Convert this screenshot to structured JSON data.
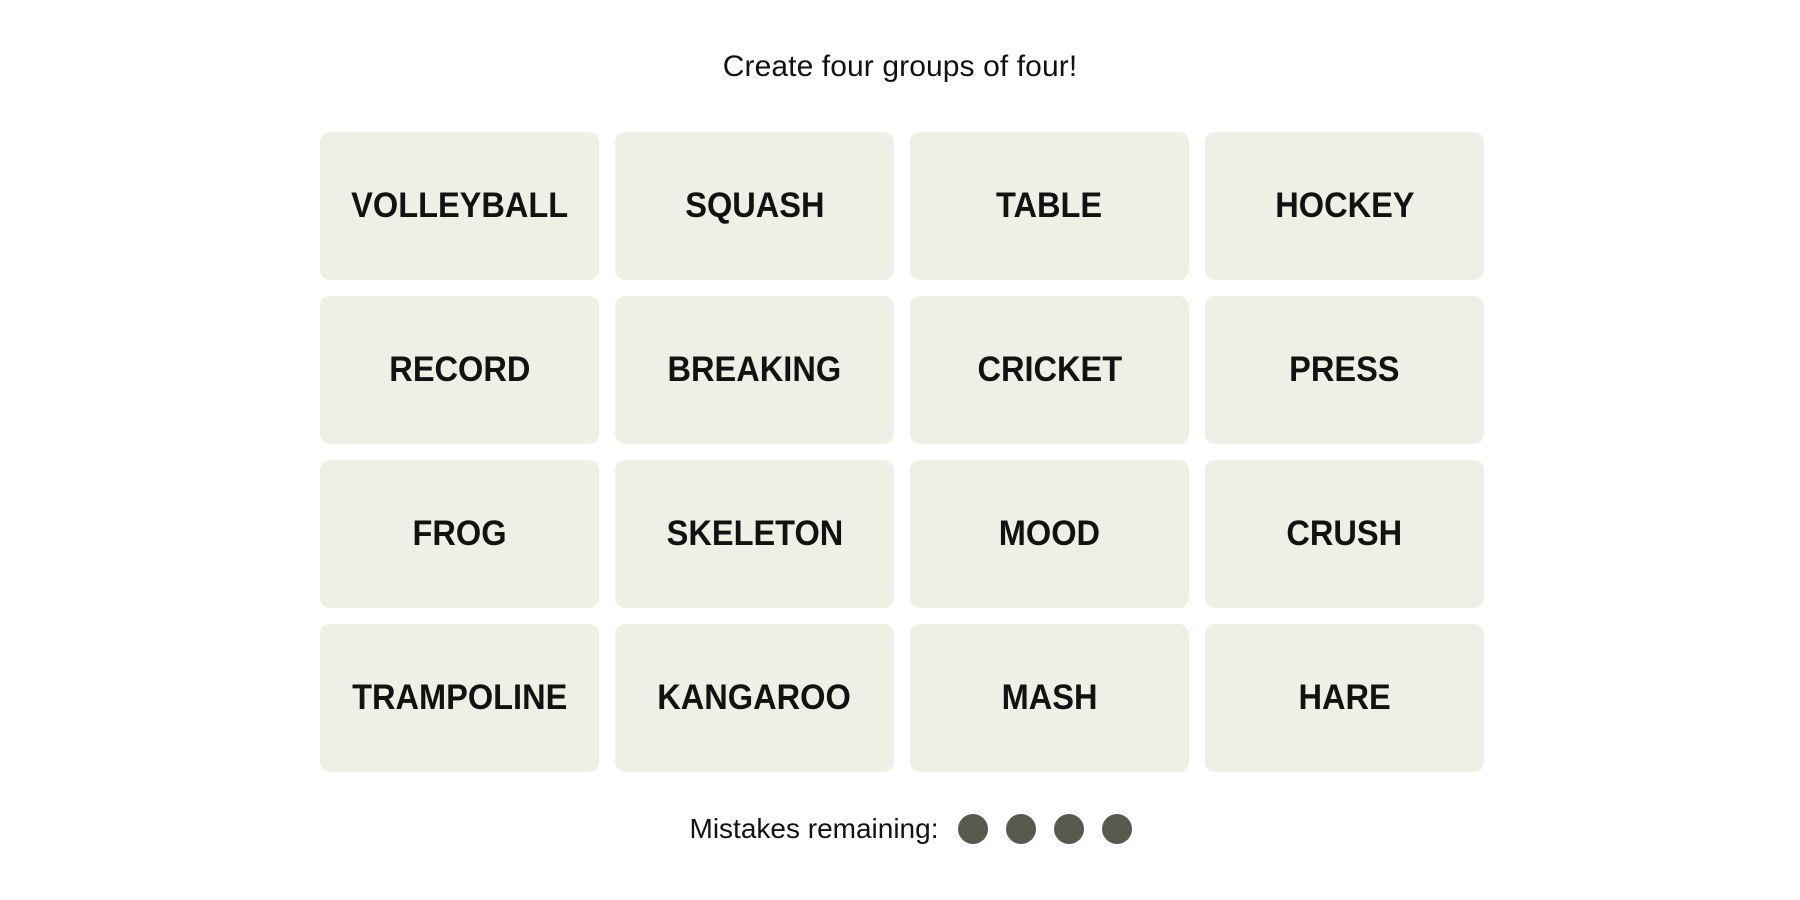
{
  "header": {
    "prompt": "Create four groups of four!"
  },
  "board": {
    "tiles": [
      "VOLLEYBALL",
      "SQUASH",
      "TABLE",
      "HOCKEY",
      "RECORD",
      "BREAKING",
      "CRICKET",
      "PRESS",
      "FROG",
      "SKELETON",
      "MOOD",
      "CRUSH",
      "TRAMPOLINE",
      "KANGAROO",
      "MASH",
      "HARE"
    ],
    "tile_color": "#efefe6"
  },
  "status": {
    "mistakes_label": "Mistakes remaining:",
    "mistakes_remaining": 4,
    "dot_color": "#5a594e"
  }
}
